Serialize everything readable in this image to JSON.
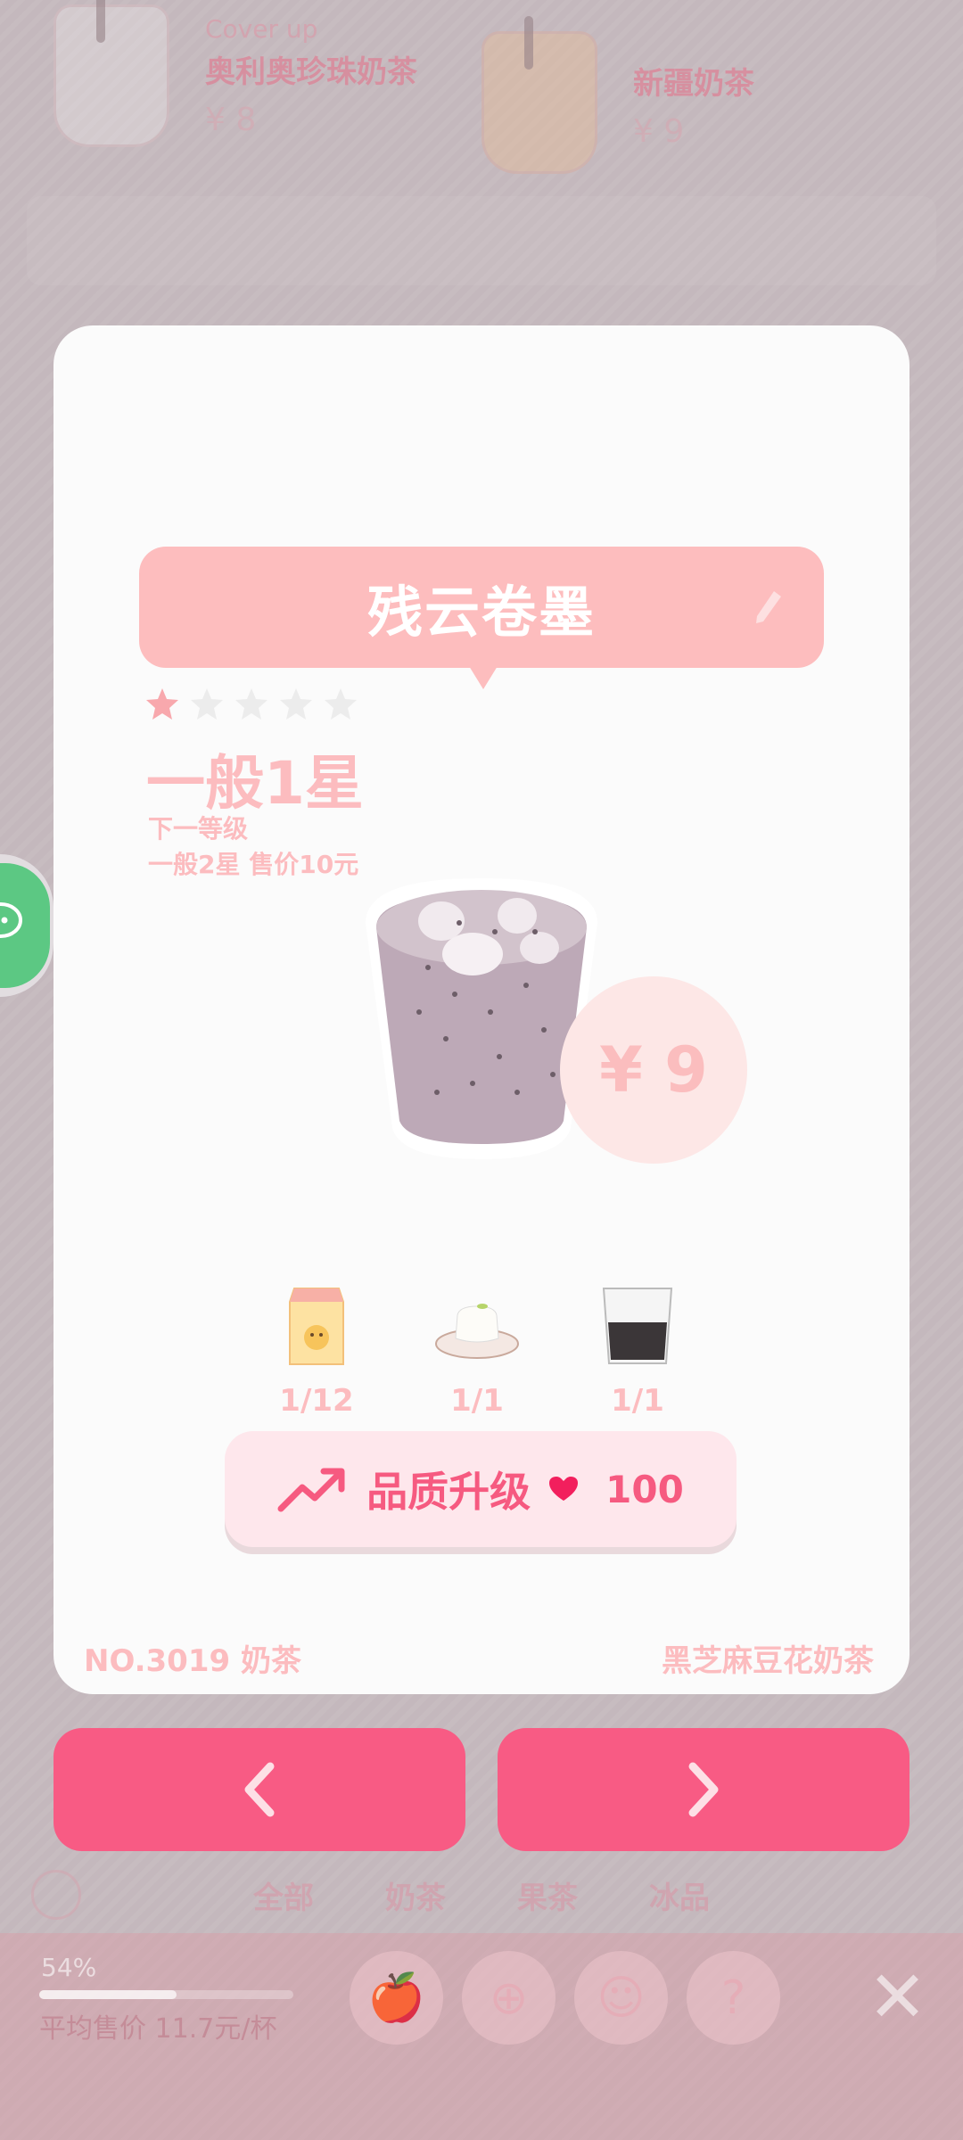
{
  "background": {
    "cards": [
      {
        "tag": "Cover up",
        "name": "奥利奥珍珠奶茶",
        "price": "¥ 8"
      },
      {
        "name": "新疆奶茶",
        "price": "¥ 9"
      }
    ],
    "filters": [
      "全部",
      "奶茶",
      "果茶",
      "冰品"
    ],
    "progress_pct": "54%",
    "progress_value": 0.54,
    "avg_price": "平均售价 11.7元/杯"
  },
  "modal": {
    "title": "残云卷墨",
    "stars_filled": 1,
    "stars_total": 5,
    "rank": "一般1星",
    "next_label": "下一等级",
    "next_value": "一般2星 售价10元",
    "price": "¥ 9",
    "ingredients": [
      {
        "icon": "milk-carton-icon",
        "count": "1/12"
      },
      {
        "icon": "tofu-pudding-icon",
        "count": "1/1"
      },
      {
        "icon": "black-sesame-cup-icon",
        "count": "1/1"
      }
    ],
    "upgrade": {
      "label": "品质升级",
      "cost": "100"
    },
    "footer_left": "NO.3019 奶茶",
    "footer_right": "黑芝麻豆花奶茶"
  },
  "colors": {
    "accent": "#f85b84",
    "title_pink": "#fdbdbe",
    "text_pink": "#fcbcbf",
    "share_green": "#5cc883"
  }
}
